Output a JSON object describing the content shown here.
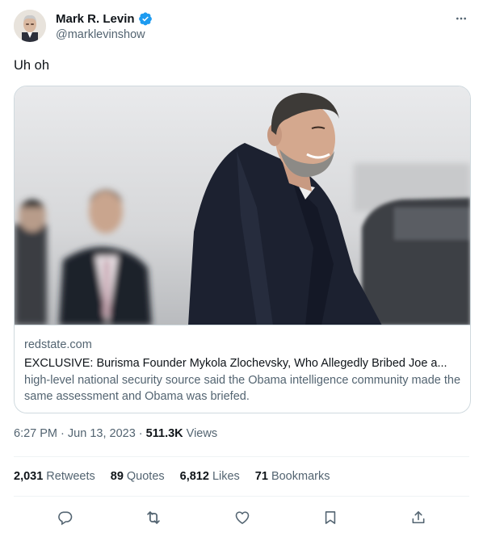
{
  "author": {
    "display_name": "Mark R. Levin",
    "handle": "@marklevinshow",
    "verified_badge": "verified-badge-icon",
    "avatar": "avatar-photo"
  },
  "more_icon": "more-horizontal-icon",
  "tweet": {
    "text": "Uh oh"
  },
  "card": {
    "image": "photo-man-in-dark-coat-smiling",
    "domain": "redstate.com",
    "title": "EXCLUSIVE: Burisma Founder Mykola Zlochevsky, Who Allegedly Bribed Joe a...",
    "description": "high-level national security source said the Obama intelligence community made the same assessment and Obama was briefed."
  },
  "meta": {
    "time": "6:27 PM",
    "separator": "·",
    "date": "Jun 13, 2023",
    "views_count": "511.3K",
    "views_label": "Views"
  },
  "stats": [
    {
      "count": "2,031",
      "label": "Retweets"
    },
    {
      "count": "89",
      "label": "Quotes"
    },
    {
      "count": "6,812",
      "label": "Likes"
    },
    {
      "count": "71",
      "label": "Bookmarks"
    }
  ],
  "actions": [
    "reply-icon",
    "retweet-icon",
    "like-icon",
    "bookmark-icon",
    "share-icon"
  ],
  "colors": {
    "text_primary": "#0f1419",
    "text_secondary": "#536471",
    "verified_blue": "#1d9bf0",
    "border": "#cfd9de",
    "divider": "#eff3f4"
  }
}
